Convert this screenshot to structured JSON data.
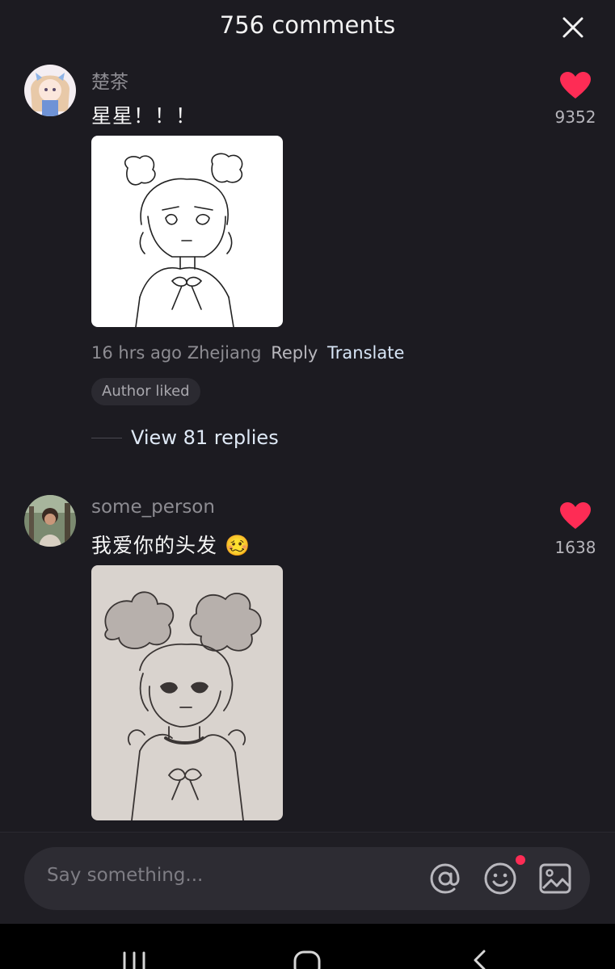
{
  "header": {
    "title": "756 comments"
  },
  "comments": [
    {
      "username": "楚茶",
      "text": "星星！！！",
      "likes": "9352",
      "time": "16 hrs ago",
      "location": "Zhejiang",
      "reply_label": "Reply",
      "translate_label": "Translate",
      "badge": "Author liked",
      "view_replies": "View 81 replies"
    },
    {
      "username": "some_person",
      "text": "我爱你的头发",
      "emoji": "🥴",
      "likes": "1638"
    }
  ],
  "input": {
    "placeholder": "Say something..."
  },
  "colors": {
    "background": "#1c1b21",
    "like": "#fe2c55",
    "notification_dot": "#fe2c55"
  },
  "icons": [
    "close-icon",
    "heart-icon",
    "at-icon",
    "emoji-icon",
    "image-icon",
    "recents-icon",
    "home-icon",
    "back-icon"
  ]
}
